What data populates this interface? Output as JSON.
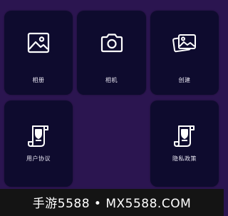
{
  "tiles": [
    {
      "label": "相册",
      "icon": "image-icon"
    },
    {
      "label": "相机",
      "icon": "camera-icon"
    },
    {
      "label": "创建",
      "icon": "images-stack-icon"
    },
    {
      "label": "用户协议",
      "icon": "scroll-document-icon"
    },
    {
      "label": "隐私政策",
      "icon": "scroll-document-icon"
    }
  ],
  "watermark": "手游5588 • MX5588.COM",
  "colors": {
    "background": "#2b1550",
    "tile": "#0e0b2e",
    "text": "#ffffff",
    "banner": "#141414"
  }
}
